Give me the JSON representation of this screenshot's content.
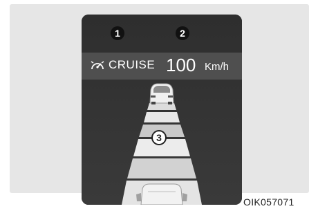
{
  "markers": {
    "cruise_indicator": "1",
    "set_speed": "2",
    "vehicle_distance": "3"
  },
  "status": {
    "mode_label": "CRUISE",
    "speed_value": "100",
    "speed_unit": "Km/h"
  },
  "figure_code": "OIK057071",
  "icons": {
    "cruise": "cruise-control-icon",
    "lead_vehicle": "car-rear-icon",
    "own_vehicle": "car-hood-icon"
  },
  "colors": {
    "display_background": "#2b2b2b",
    "status_bar": "#4f4f4f",
    "road_light": "#e9e9e9",
    "road_dark": "#c4c4c4",
    "frame": "#e6e6e6"
  }
}
